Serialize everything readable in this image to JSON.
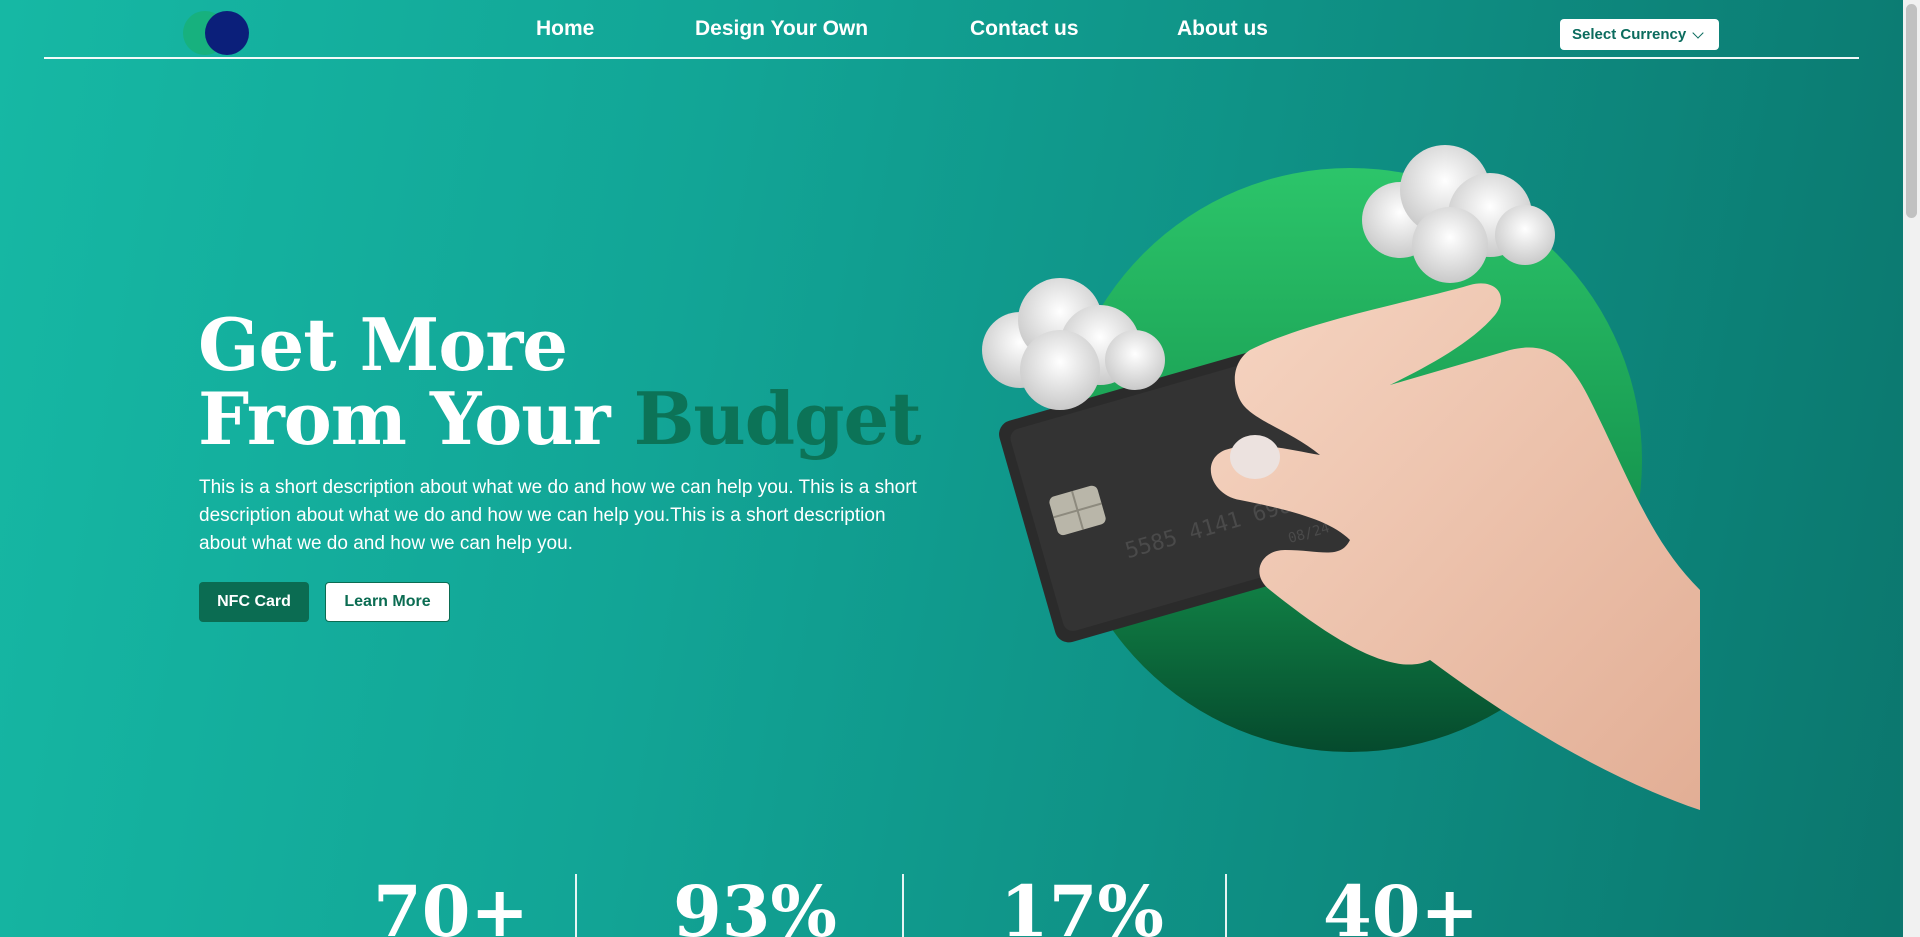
{
  "nav": {
    "home": "Home",
    "design": "Design Your Own",
    "contact": "Contact us",
    "about": "About us"
  },
  "currency": {
    "label": "Select Currency"
  },
  "hero": {
    "title_line1": "Get More",
    "title_line2_start": "From Your ",
    "title_accent": "Budget",
    "description": "This is a short description about what we do and how we can help you. This is a short description about what we do and how we can help you.This is a short description about what we do and how we can help you.",
    "btn_primary": "NFC Card",
    "btn_secondary": "Learn More",
    "card_number": "5585 4141 6985",
    "card_expiry": "08/24"
  },
  "stats": [
    {
      "value": "70+"
    },
    {
      "value": "93%"
    },
    {
      "value": "17%"
    },
    {
      "value": "40+"
    }
  ],
  "colors": {
    "accent": "#0c7357",
    "background_start": "#16b8a4",
    "background_end": "#0b766d",
    "logo_navy": "#0b1f7a",
    "logo_green": "#17b07a",
    "circle_green": "#22c068"
  }
}
